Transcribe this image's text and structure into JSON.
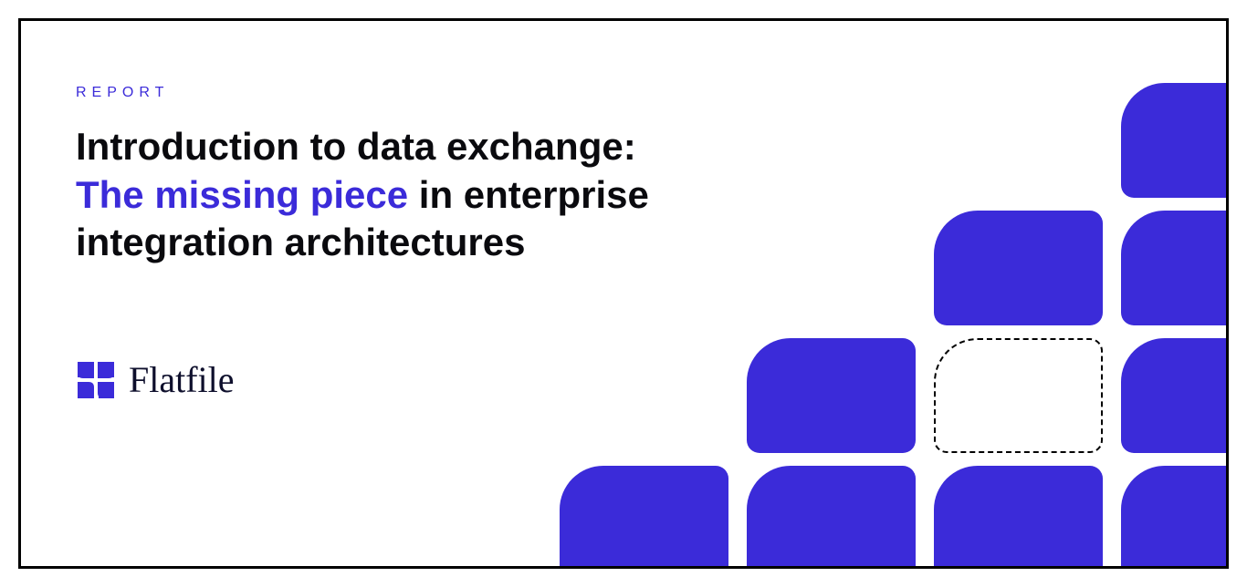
{
  "eyebrow": "REPORT",
  "headline": {
    "line1": "Introduction to data exchange:",
    "accent": "The missing piece",
    "rest": " in enterprise integration architectures"
  },
  "brand": {
    "name": "Flatfile"
  },
  "colors": {
    "accent": "#3b2bd9",
    "text": "#0a0a0e",
    "brandText": "#0e0f2c"
  }
}
